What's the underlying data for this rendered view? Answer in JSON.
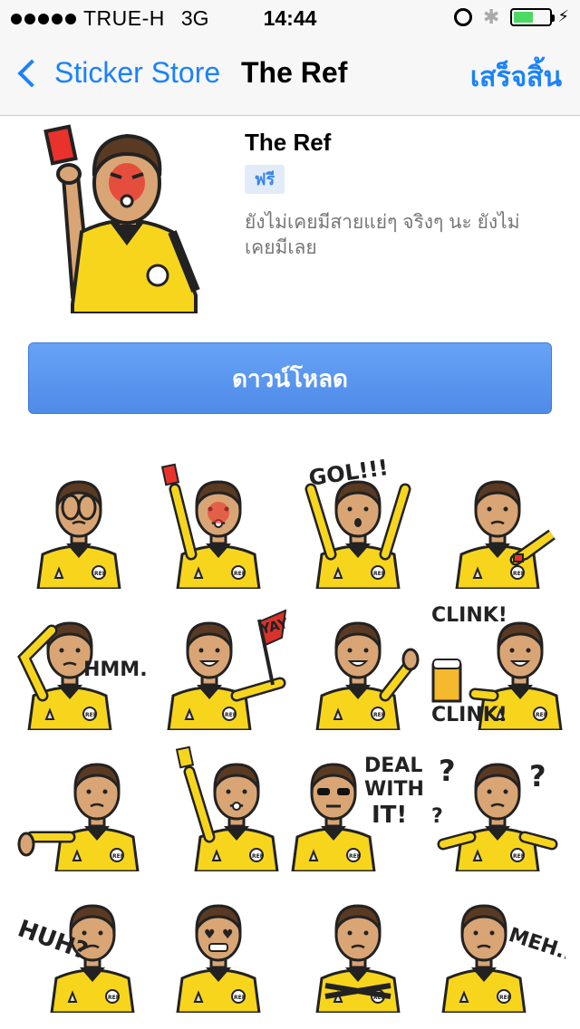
{
  "status_bar": {
    "carrier": "TRUE-H",
    "network": "3G",
    "time": "14:44"
  },
  "nav": {
    "back_label": "Sticker Store",
    "title": "The Ref",
    "done_label": "เสร็จสิ้น"
  },
  "pack": {
    "title": "The Ref",
    "price": "ฟรี",
    "description": "ยังไม่เคยมีสายแย่ๆ จริงๆ นะ ยังไม่เคยมีเลย",
    "download_label": "ดาวน์โหลด"
  },
  "colors": {
    "accent": "#1a82fb",
    "shirt": "#f7d51d",
    "skin": "#d9a574",
    "hair": "#5a3a22"
  },
  "stickers": [
    {
      "pose": "face-palm",
      "caption": ""
    },
    {
      "pose": "red-card",
      "caption": ""
    },
    {
      "pose": "cheer",
      "caption": "GOL!!!"
    },
    {
      "pose": "watch",
      "caption": ""
    },
    {
      "pose": "think",
      "caption": "HMM..."
    },
    {
      "pose": "flag",
      "caption": "YAY!"
    },
    {
      "pose": "thumb-up",
      "caption": ""
    },
    {
      "pose": "beer",
      "caption": "CLINK!"
    },
    {
      "pose": "thumb-down",
      "caption": ""
    },
    {
      "pose": "yellow-card",
      "caption": ""
    },
    {
      "pose": "sunglasses",
      "caption": "DEAL WITH IT!"
    },
    {
      "pose": "confused",
      "caption": "?"
    },
    {
      "pose": "huh",
      "caption": "HUH?"
    },
    {
      "pose": "love",
      "caption": ""
    },
    {
      "pose": "arms-crossed",
      "caption": ""
    },
    {
      "pose": "meh",
      "caption": "MEH..."
    }
  ],
  "sticker_text": {
    "clink_second": "CLINK!",
    "ref_badge": "REF"
  }
}
